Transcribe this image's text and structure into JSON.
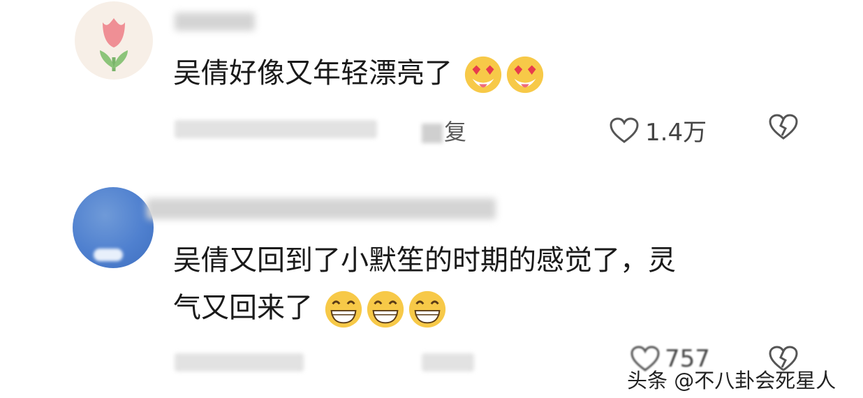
{
  "comments": [
    {
      "text": "吴倩好像又年轻漂亮了",
      "emoji": "heart-eyes-tongue-emoji",
      "reply_label": "复",
      "like_count": "1.4万",
      "heart_icon": "heart-outline-icon",
      "dislike_icon": "broken-heart-icon"
    },
    {
      "text_line1": "吴倩又回到了小默笙的时期的感觉了，灵",
      "text_line2": "气又回来了",
      "emoji": "grin-emoji",
      "like_count": "757",
      "heart_icon": "heart-outline-icon",
      "dislike_icon": "broken-heart-icon"
    }
  ],
  "watermark": "头条 @不八卦会死星人",
  "colors": {
    "text": "#1a1a1a",
    "icon": "#555555",
    "emoji": "#f7c948"
  }
}
